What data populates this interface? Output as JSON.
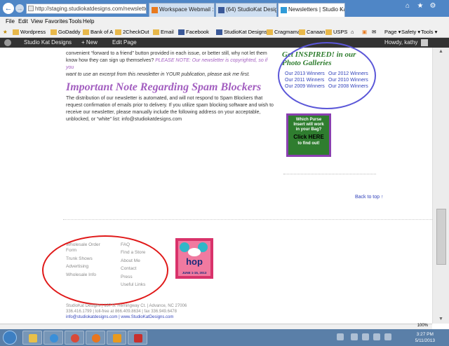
{
  "browser": {
    "address_url": "http://staging.studiokatdesigns.com/newsletter",
    "tabs": [
      {
        "label": "Workspace Webmail :: Mail Ind..."
      },
      {
        "label": "(64) StudioKat Designs"
      },
      {
        "label": "Newsletters | Studio Kat De..."
      }
    ],
    "menu": [
      "File",
      "Edit",
      "View",
      "Favorites",
      "Tools",
      "Help"
    ],
    "favorites": [
      "Wordpress",
      "GoDaddy",
      "Bank of A",
      "2CheckOut",
      "Email",
      "Facebook",
      "StudioKat Designs",
      "Cragmama",
      "Canaan",
      "USPS"
    ],
    "tools": [
      "Page ▾",
      "Safety ▾",
      "Tools ▾"
    ],
    "zoom": "100%"
  },
  "wp_bar": {
    "site": "Studio Kat Designs",
    "new": "+ New",
    "edit": "Edit Page",
    "howdy": "Howdy, kathy"
  },
  "article": {
    "partial_line": "convenient “forward to a friend” button provided in each issue, or better still, why not let them",
    "line2": "know how they can sign up themselves?",
    "please_note": "PLEASE NOTE:",
    "copyright_note": "Our newsletter is copyrighted, so if you",
    "excerpt_line": "want to use an excerpt from this newsletter in YOUR publication, please ask me first.",
    "spam_heading": "Important Note Regarding Spam Blockers",
    "spam_lines": [
      "The distribution of our newsletter is automated, and will not respond to Spam Blockers that",
      "request confirmation of emails prior to delivery. If you utilize spam blocking software and wish to",
      "receive our newsletter, please manually include the following address on your acceptable,",
      "unblocked, or “white” list: info@studiokatdesigns.com"
    ]
  },
  "sidebar": {
    "gallery_title_1": "Get INSPIRED! in our",
    "gallery_title_2": "Photo Galleries",
    "winners": [
      "Our 2013 Winners",
      "Our 2012 Winners",
      "Our 2011 Winners",
      "Our 2010 Winners",
      "Our 2009 Winners",
      "Our 2008 Winners"
    ],
    "purse_ad": {
      "line1": "Which Purse",
      "line2": "Insert will work",
      "line3": "in your Bag?",
      "cta": "Click HERE",
      "line4": "to find out!"
    },
    "back_to_top": "Back to top ↑"
  },
  "footer": {
    "col1": [
      "Wholesale Order",
      "Form",
      "Trunk Shows",
      "Advertising",
      "Wholesale Info"
    ],
    "col2": [
      "FAQ",
      "Find a Store",
      "About Me",
      "Contact",
      "Press",
      "Useful Links"
    ],
    "hop_badge": {
      "word": "hop",
      "dates": "JUNE 1-15, 2013"
    },
    "address_line": "StudioKat Designs | 137 S. Hemingway Ct. | Advance, NC 27006",
    "phone_line": "336.416.1799 | toll-free at 866.409.8634 | fax 336.949.6478",
    "email_line": "info@studiokatdesigns.com | www.StudioKatDesigns.com"
  },
  "taskbar": {
    "time": "3:27 PM",
    "date": "5/11/2013"
  },
  "colors": {
    "annotation_blue": "#5b57d8",
    "annotation_red": "#e01818",
    "heading_purple": "#a35fc0",
    "gallery_green": "#2f7d2f"
  }
}
